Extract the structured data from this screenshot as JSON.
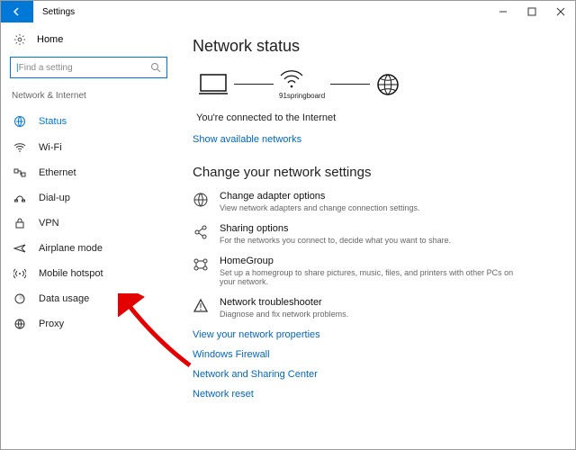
{
  "window": {
    "title": "Settings"
  },
  "sidebar": {
    "home": "Home",
    "search_placeholder": "Find a setting",
    "section": "Network & Internet",
    "items": [
      {
        "label": "Status"
      },
      {
        "label": "Wi-Fi"
      },
      {
        "label": "Ethernet"
      },
      {
        "label": "Dial-up"
      },
      {
        "label": "VPN"
      },
      {
        "label": "Airplane mode"
      },
      {
        "label": "Mobile hotspot"
      },
      {
        "label": "Data usage"
      },
      {
        "label": "Proxy"
      }
    ]
  },
  "main": {
    "heading": "Network status",
    "network_name": "91springboard",
    "connected_msg": "You're connected to the Internet",
    "show_networks": "Show available networks",
    "change_heading": "Change your network settings",
    "options": [
      {
        "title": "Change adapter options",
        "desc": "View network adapters and change connection settings."
      },
      {
        "title": "Sharing options",
        "desc": "For the networks you connect to, decide what you want to share."
      },
      {
        "title": "HomeGroup",
        "desc": "Set up a homegroup to share pictures, music, files, and printers with other PCs on your network."
      },
      {
        "title": "Network troubleshooter",
        "desc": "Diagnose and fix network problems."
      }
    ],
    "links": [
      "View your network properties",
      "Windows Firewall",
      "Network and Sharing Center",
      "Network reset"
    ]
  }
}
